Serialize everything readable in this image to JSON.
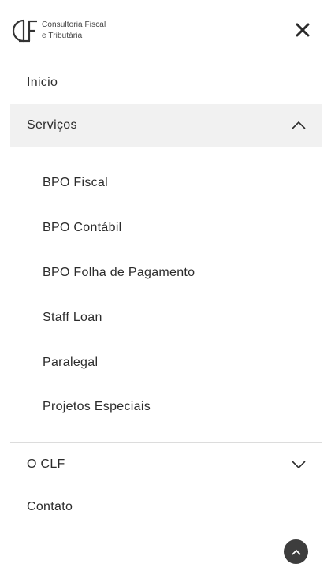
{
  "header": {
    "logo_lines": [
      "Consultoria Fiscal",
      "e Tributária"
    ],
    "logo_mark": "CLF",
    "close_icon": "close-icon"
  },
  "menu": {
    "items": [
      {
        "label": "Inicio"
      },
      {
        "label": "Serviços",
        "expanded": true,
        "icon": "chevron-up-icon"
      },
      {
        "label": "O CLF",
        "expanded": false,
        "icon": "chevron-down-icon"
      },
      {
        "label": "Contato"
      }
    ],
    "services_submenu": [
      "BPO Fiscal",
      "BPO Contábil",
      "BPO Folha de Pagamento",
      "Staff Loan",
      "Paralegal",
      "Projetos Especiais"
    ]
  },
  "scroll_top": {
    "icon": "chevron-up-icon"
  },
  "colors": {
    "text": "#2b2b2b",
    "active_bg": "#f1f1f1",
    "divider": "#dcdcdc",
    "scroll_button": "#3d3d3d"
  }
}
